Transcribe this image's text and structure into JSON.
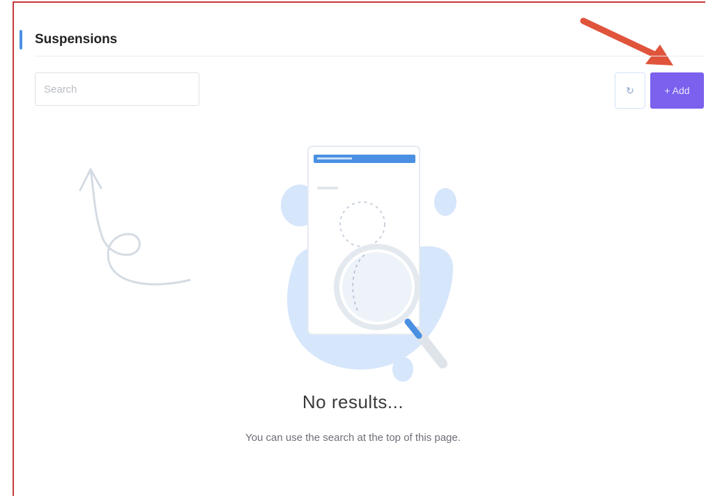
{
  "section": {
    "title": "Suspensions"
  },
  "toolbar": {
    "search_placeholder": "Search",
    "refresh_icon": "refresh-icon",
    "add_label": "+ Add"
  },
  "empty_state": {
    "title": "No results...",
    "subtitle": "You can use the search at the top of this page."
  },
  "colors": {
    "accent": "#4a90e2",
    "add_button": "#7b61ee",
    "annotation_arrow": "#e0543c",
    "frame_border": "#c4373a"
  }
}
